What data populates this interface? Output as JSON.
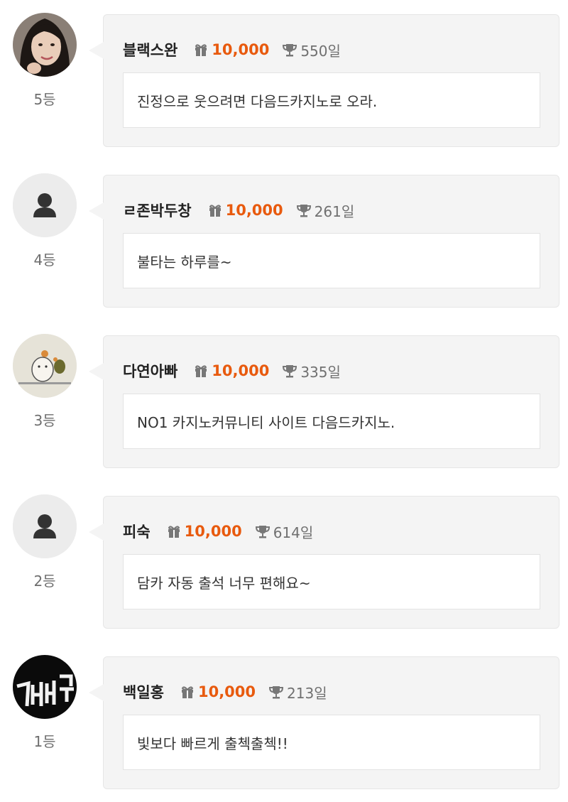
{
  "colors": {
    "accent": "#e85a0e",
    "card_bg": "#f4f4f4",
    "icon_gray": "#777777"
  },
  "entries": [
    {
      "nickname": "블랙스완",
      "points": "10,000",
      "days": "550일",
      "message": "진정으로 웃으려면 다음드카지노로 오라.",
      "rank": "5등",
      "avatar": "photo-woman"
    },
    {
      "nickname": "ㄹ존박두창",
      "points": "10,000",
      "days": "261일",
      "message": "불타는 하루를~",
      "rank": "4등",
      "avatar": "default-user-icon"
    },
    {
      "nickname": "다연아빠",
      "points": "10,000",
      "days": "335일",
      "message": "NO1 카지노커뮤니티 사이트 다음드카지노.",
      "rank": "3등",
      "avatar": "photo-cat-drawing"
    },
    {
      "nickname": "피숙",
      "points": "10,000",
      "days": "614일",
      "message": "담카 자동 출석 너무 편해요~",
      "rank": "2등",
      "avatar": "default-user-icon"
    },
    {
      "nickname": "백일홍",
      "points": "10,000",
      "days": "213일",
      "message": "빛보다 빠르게 출첵출첵!!",
      "rank": "1등",
      "avatar": "photo-neon-sign"
    }
  ]
}
